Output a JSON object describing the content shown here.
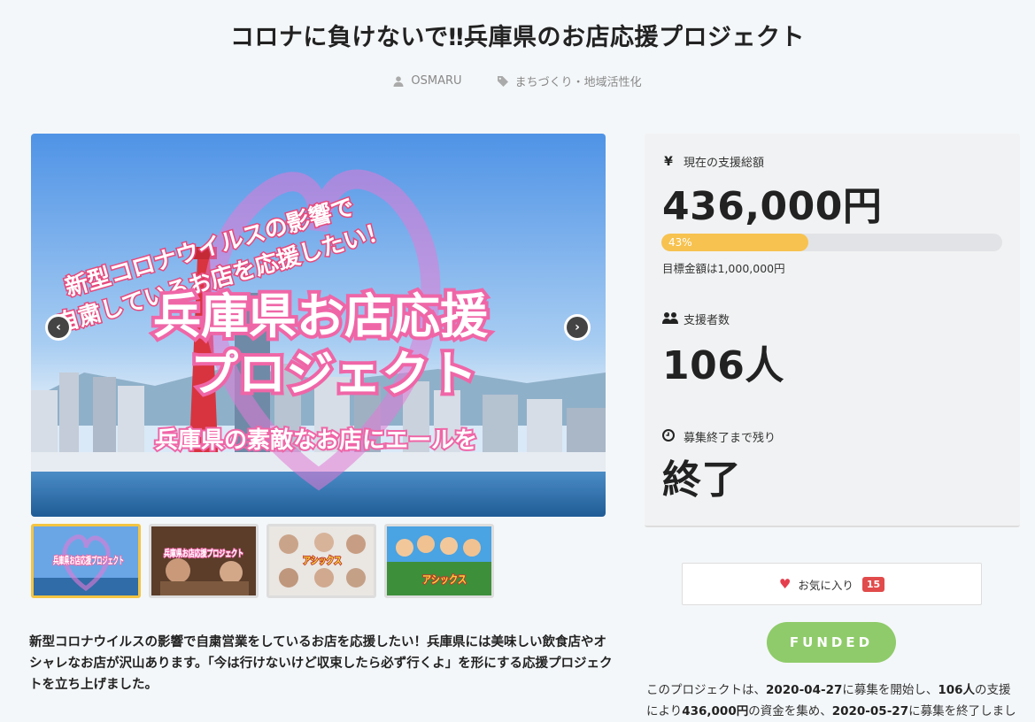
{
  "title": "コロナに負けないで‼兵庫県のお店応援プロジェクト",
  "meta": {
    "author": "OSMARU",
    "category": "まちづくり・地域活性化"
  },
  "hero": {
    "caption_line1": "新型コロナウイルスの影響で",
    "caption_line2": "自粛しているお店を応援したい！",
    "main_line1": "兵庫県お店応援",
    "main_line2": "プロジェクト",
    "sub_line": "兵庫県の素敵なお店にエールを"
  },
  "thumbnails": [
    {
      "label": "兵庫県お店応援プロジェクト"
    },
    {
      "label": "兵庫県お店応援プロジェクト"
    },
    {
      "label": "アシックス"
    },
    {
      "label": "アシックス"
    }
  ],
  "description": "新型コロナウイルスの影響で自粛営業をしているお店を応援したい！兵庫県には美味しい飲食店やオシャレなお店が沢山あります。「今は行けないけど収束したら必ず行くよ」を形にする応援プロジェクトを立ち上げました。",
  "stats": {
    "amount_label": "現在の支援総額",
    "amount_value": "436,000円",
    "progress_percent": 43,
    "progress_label": "43%",
    "goal": "目標金額は1,000,000円",
    "supporters_label": "支援者数",
    "supporters_value": "106人",
    "remaining_label": "募集終了まで残り",
    "remaining_value": "終了"
  },
  "favorite": {
    "label": "お気に入り",
    "count": "15"
  },
  "funded_badge": "FUNDED",
  "summary": {
    "p1": "このプロジェクトは、",
    "start": "2020-04-27",
    "p2": "に募集を開始し、",
    "backers": "106人",
    "p3": "の支援により",
    "amount": "436,000円",
    "p4": "の資金を集め、",
    "end": "2020-05-27",
    "p5": "に募集を終了しました"
  },
  "colors": {
    "accent_yellow": "#f7c24f",
    "funded_green": "#8fcb6a",
    "heart_red": "#e53e4d"
  }
}
